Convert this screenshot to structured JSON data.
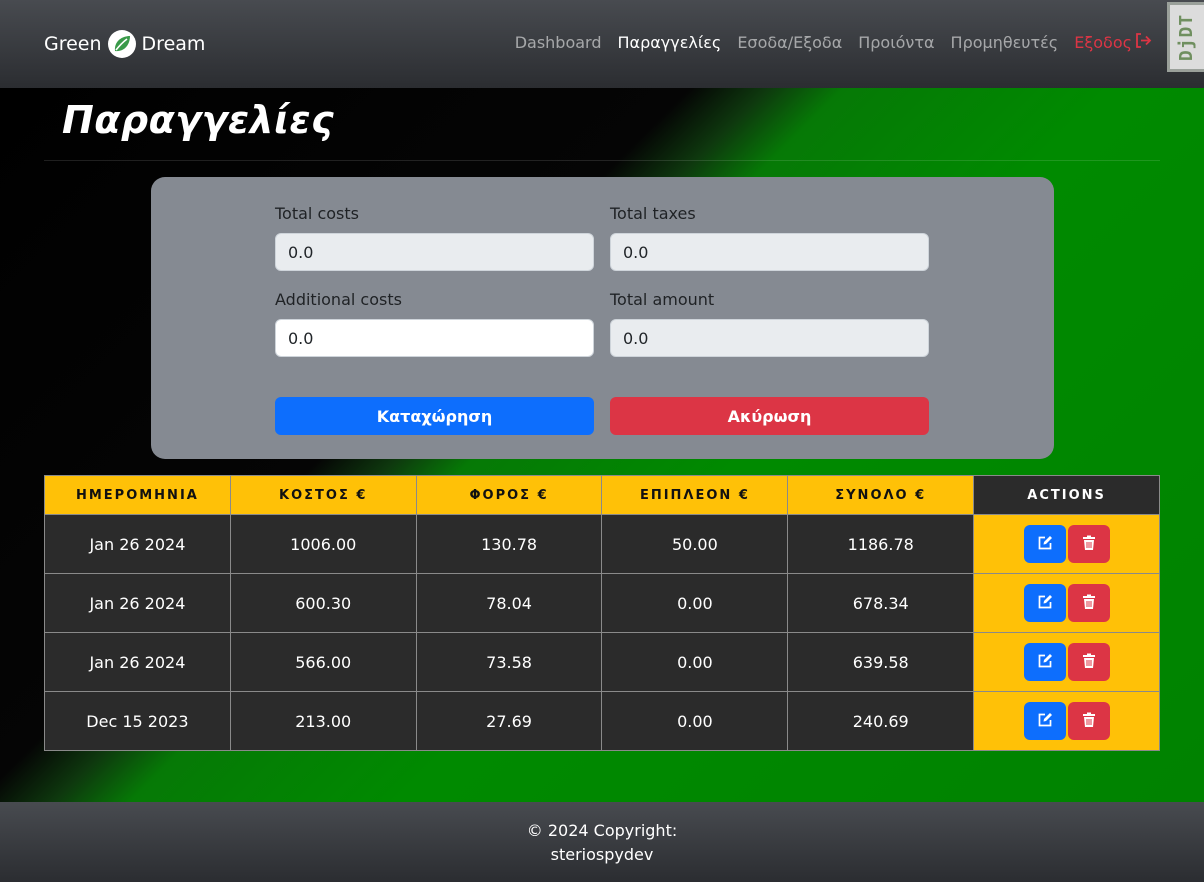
{
  "navbar": {
    "brand_left": "Green",
    "brand_right": "Dream",
    "links": [
      {
        "label": "Dashboard"
      },
      {
        "label": "Παραγγελίες"
      },
      {
        "label": "Εσοδα/Εξοδα"
      },
      {
        "label": "Προιόντα"
      },
      {
        "label": "Προμηθευτές"
      },
      {
        "label": "Εξοδος"
      }
    ],
    "djdt": "DjDT"
  },
  "page": {
    "title": "Παραγγελίες"
  },
  "form": {
    "total_costs": {
      "label": "Total costs",
      "value": "0.0"
    },
    "total_taxes": {
      "label": "Total taxes",
      "value": "0.0"
    },
    "additional_costs": {
      "label": "Additional costs",
      "value": "0.0"
    },
    "total_amount": {
      "label": "Total amount",
      "value": "0.0"
    },
    "submit_label": "Καταχώρηση",
    "cancel_label": "Ακύρωση"
  },
  "table": {
    "headers": [
      "ΗΜΕΡΟΜΗΝΙΑ",
      "ΚΟΣΤΟΣ €",
      "ΦΟΡΟΣ €",
      "ΕΠΙΠΛΕΟΝ €",
      "ΣΥΝΟΛΟ €",
      "ACTIONS"
    ],
    "rows": [
      {
        "date": "Jan 26 2024",
        "cost": "1006.00",
        "tax": "130.78",
        "extra": "50.00",
        "total": "1186.78"
      },
      {
        "date": "Jan 26 2024",
        "cost": "600.30",
        "tax": "78.04",
        "extra": "0.00",
        "total": "678.34"
      },
      {
        "date": "Jan 26 2024",
        "cost": "566.00",
        "tax": "73.58",
        "extra": "0.00",
        "total": "639.58"
      },
      {
        "date": "Dec 15 2023",
        "cost": "213.00",
        "tax": "27.69",
        "extra": "0.00",
        "total": "240.69"
      }
    ]
  },
  "footer": {
    "line1": "© 2024 Copyright:",
    "line2": "steriospydev"
  }
}
